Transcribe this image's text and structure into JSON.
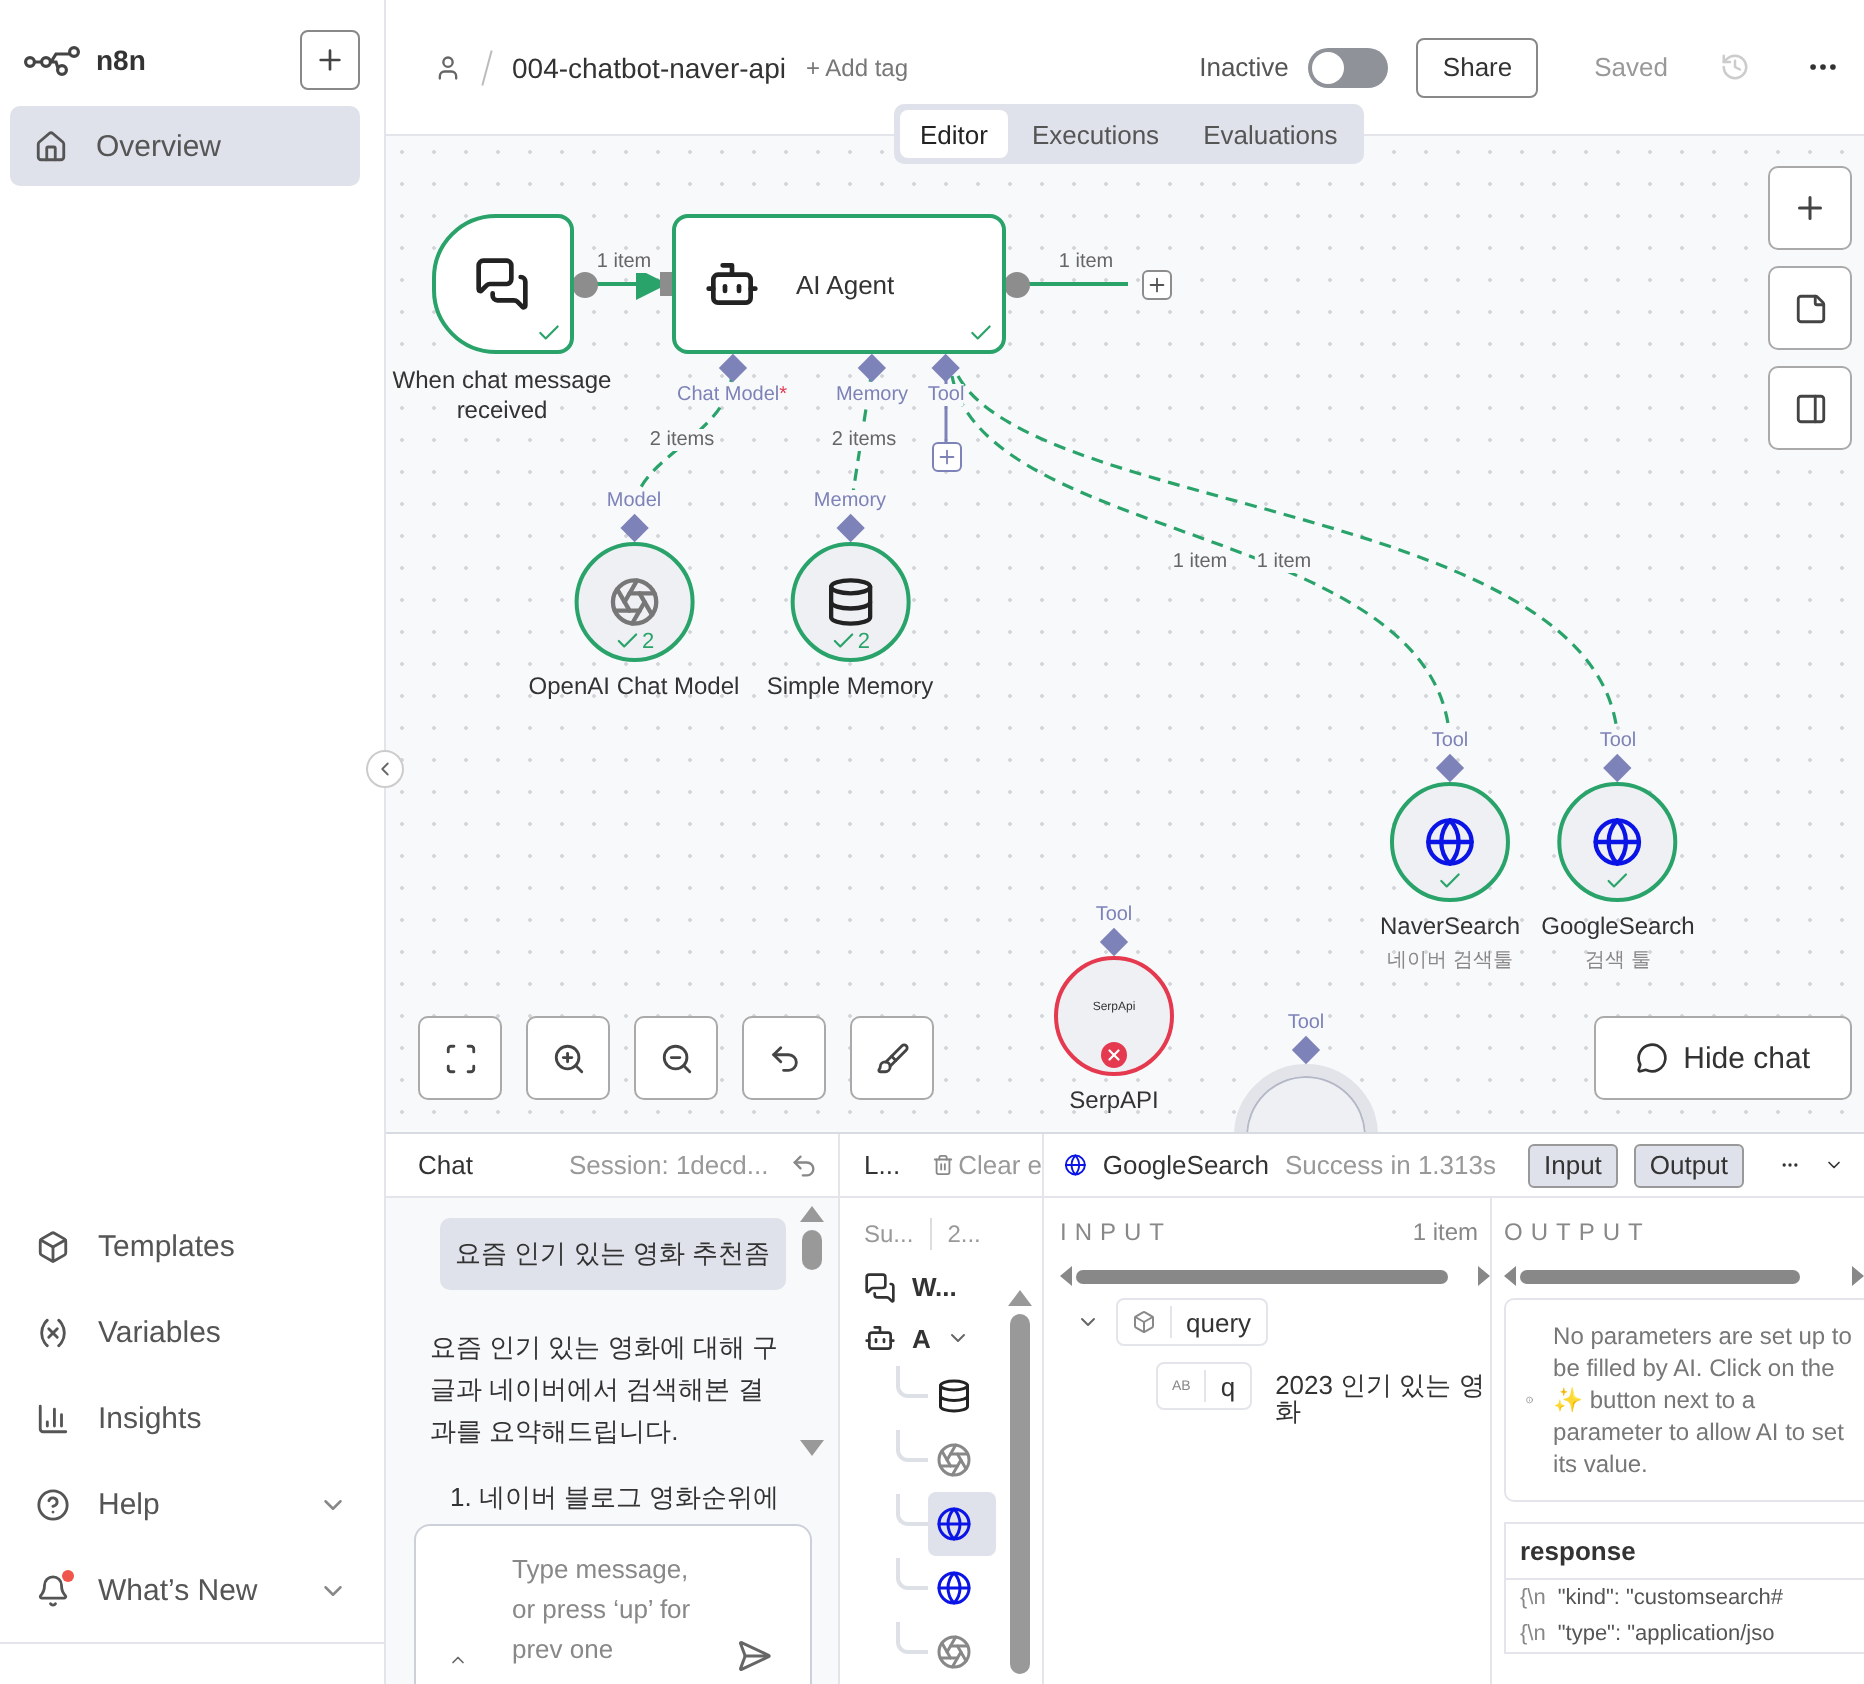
{
  "sidebar": {
    "logo": "n8n",
    "items": [
      {
        "label": "Overview",
        "selected": true
      }
    ],
    "footer_items": [
      {
        "label": "Templates",
        "expandable": false,
        "notification": false
      },
      {
        "label": "Variables",
        "expandable": false,
        "notification": false
      },
      {
        "label": "Insights",
        "expandable": false,
        "notification": false
      },
      {
        "label": "Help",
        "expandable": true,
        "notification": false
      },
      {
        "label": "What’s New",
        "expandable": true,
        "notification": true
      }
    ]
  },
  "header": {
    "title": "004-chatbot-naver-api",
    "add_tag": "+ Add tag",
    "status_label": "Inactive",
    "active": false,
    "share": "Share",
    "save_state": "Saved"
  },
  "tabs": [
    {
      "label": "Editor",
      "selected": true
    },
    {
      "label": "Executions",
      "selected": false
    },
    {
      "label": "Evaluations",
      "selected": false
    }
  ],
  "canvas": {
    "nodes": [
      {
        "kind": "trigger",
        "label": "When chat message received",
        "failed": false
      },
      {
        "kind": "agent",
        "label": "AI Agent",
        "failed": false,
        "ports": [
          {
            "label": "Chat Model",
            "required_mark": "*"
          },
          {
            "label": "Memory"
          },
          {
            "label": "Tool"
          }
        ]
      },
      {
        "kind": "sub",
        "label": "OpenAI Chat Model",
        "input": "Model",
        "failed": false,
        "count": "2"
      },
      {
        "kind": "sub",
        "label": "Simple Memory",
        "input": "Memory",
        "failed": false,
        "count": "2"
      },
      {
        "kind": "sub",
        "label": "NaverSearch",
        "subtitle": "네이버 검색툴",
        "input": "Tool",
        "failed": false
      },
      {
        "kind": "sub",
        "label": "GoogleSearch",
        "subtitle": "검색 툴",
        "input": "Tool",
        "failed": false
      },
      {
        "kind": "sub",
        "label": "SerpAPI",
        "icon_text": "SerpApi",
        "input": "Tool",
        "failed": true
      },
      {
        "kind": "partial",
        "input": "Tool"
      }
    ],
    "edges": [
      {
        "label": "1 item"
      },
      {
        "label": "1 item"
      },
      {
        "label": "2 items"
      },
      {
        "label": "2 items"
      },
      {
        "label": "1 item"
      },
      {
        "label": "1 item"
      }
    ],
    "hide_chat": "Hide chat"
  },
  "chat": {
    "title": "Chat",
    "session": "Session: 1decd...",
    "messages": [
      {
        "kind": "user",
        "text": "요즘 인기 있는 영화 추천좀"
      },
      {
        "kind": "bot",
        "text": "요즘 인기 있는 영화에 대해 구글과 네이버에서 검색해본 결과를 요약해드립니다."
      },
      {
        "kind": "list",
        "text": "1. 네이버 블로그 영화순위에"
      }
    ],
    "placeholder": "Type message, or press ‘up’ for prev one"
  },
  "logs": {
    "title": "L...",
    "clear": "Clear e",
    "summary": [
      "Su...",
      "2..."
    ],
    "entries": [
      {
        "label": "W..."
      },
      {
        "label": "A",
        "expanded": true,
        "children": [
          {
            "selected": false
          },
          {
            "selected": false
          },
          {
            "selected": true
          },
          {
            "selected": false
          },
          {
            "selected": false
          }
        ]
      }
    ]
  },
  "details": {
    "title": "GoogleSearch",
    "status": "Success in 1.313s",
    "views": [
      {
        "label": "Input",
        "selected": true
      },
      {
        "label": "Output",
        "selected": true
      }
    ],
    "input": {
      "heading": "INPUT",
      "count": "1 item",
      "fields": [
        {
          "name": "query",
          "expanded": true,
          "children": [
            {
              "type_label": "AB",
              "name": "q",
              "value": "2023 인기 있는 영화"
            }
          ]
        }
      ]
    },
    "output": {
      "heading": "OUTPUT",
      "notice": "No parameters are set up to be filled by AI. Click on the ✨ button next to a parameter to allow AI to set its value.",
      "table": {
        "column": "response",
        "rows": [
          [
            "{\\n",
            "\"kind\": \"customsearch#"
          ],
          [
            "{\\n",
            "\"type\": \"application/jso"
          ]
        ]
      }
    }
  }
}
